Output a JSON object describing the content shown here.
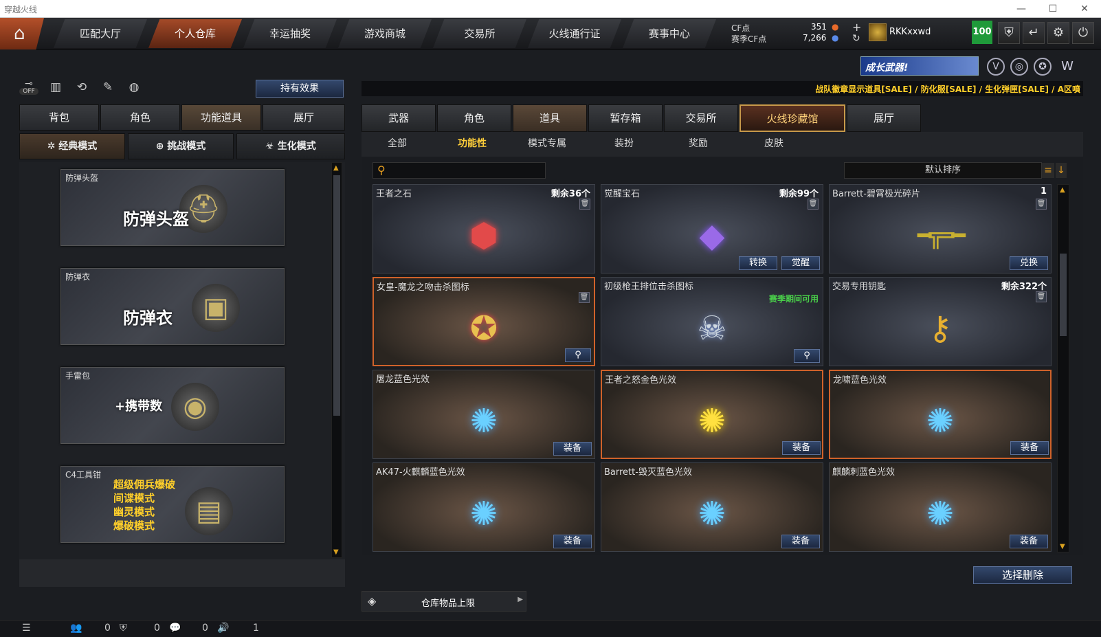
{
  "window": {
    "title": "穿越火线",
    "minimize": "—",
    "maximize": "☐",
    "close": "✕"
  },
  "topnav": {
    "home_icon": "⌂",
    "tabs": [
      {
        "label": "匹配大厅"
      },
      {
        "label": "个人仓库"
      },
      {
        "label": "幸运抽奖"
      },
      {
        "label": "游戏商城"
      },
      {
        "label": "交易所"
      },
      {
        "label": "火线通行证"
      },
      {
        "label": "赛事中心"
      }
    ],
    "active_tab": "个人仓库",
    "cf_label": "CF点",
    "season_cf_label": "赛季CF点",
    "cf_value": "351",
    "season_cf_value": "7,266",
    "plus": "+",
    "refresh": "↻",
    "username": "RKKxxwd",
    "level": "100",
    "icons": [
      "shield-icon",
      "exit-icon",
      "gear-icon",
      "power-icon"
    ]
  },
  "promo": {
    "text": "战队徽章显示道具[SALE] / 防化服[SALE] / 生化弹匣[SALE] / A区噴",
    "growth_weapon": "成长武器!"
  },
  "left": {
    "toolbar": {
      "off": "OFF",
      "effects_button": "持有效果"
    },
    "tabs": [
      {
        "label": "背包"
      },
      {
        "label": "角色"
      },
      {
        "label": "功能道具"
      },
      {
        "label": "展厅"
      }
    ],
    "modes": [
      {
        "label": "经典模式"
      },
      {
        "label": "挑战模式"
      },
      {
        "label": "生化模式"
      }
    ],
    "items": [
      {
        "name": "防弹头盔",
        "big": "防弹头盔"
      },
      {
        "name": "防弹衣",
        "big": "防弹衣"
      },
      {
        "name": "手雷包",
        "big": "+携带数"
      },
      {
        "name": "C4工具钳",
        "lines": [
          "超级佣兵爆破",
          "间谍模式",
          "幽灵模式",
          "爆破模式"
        ]
      }
    ]
  },
  "right": {
    "tabs": [
      {
        "label": "武器"
      },
      {
        "label": "角色"
      },
      {
        "label": "道具"
      },
      {
        "label": "暂存箱"
      },
      {
        "label": "交易所"
      },
      {
        "label": "火线珍藏馆"
      },
      {
        "label": "展厅"
      }
    ],
    "subtabs": [
      {
        "label": "全部"
      },
      {
        "label": "功能性"
      },
      {
        "label": "模式专属"
      },
      {
        "label": "装扮"
      },
      {
        "label": "奖励"
      },
      {
        "label": "皮肤"
      }
    ],
    "search_placeholder": "",
    "sort_label": "默认排序",
    "cards": [
      {
        "name": "王者之石",
        "count": "剩余36个"
      },
      {
        "name": "觉醒宝石",
        "count": "剩余99个",
        "btn1": "转换",
        "btn2": "觉醒"
      },
      {
        "name": "Barrett-碧霄极光碎片",
        "count": "1",
        "btn1": "兑换"
      },
      {
        "name": "女皇-魔龙之吻击杀图标"
      },
      {
        "name": "初级枪王排位击杀图标",
        "note": "赛季期间可用"
      },
      {
        "name": "交易专用钥匙",
        "count": "剩余322个"
      },
      {
        "name": "屠龙蓝色光效",
        "btn1": "装备"
      },
      {
        "name": "王者之怒金色光效",
        "btn1": "装备"
      },
      {
        "name": "龙啸蓝色光效",
        "btn1": "装备"
      },
      {
        "name": "AK47-火麒麟蓝色光效",
        "btn1": "装备"
      },
      {
        "name": "Barrett-毁灭蓝色光效",
        "btn1": "装备"
      },
      {
        "name": "麒麟刺蓝色光效",
        "btn1": "装备"
      }
    ],
    "delete_button": "选择删除",
    "capacity_label": "仓库物品上限"
  },
  "status": {
    "a": "0",
    "b": "0",
    "c": "0",
    "d": "1"
  }
}
